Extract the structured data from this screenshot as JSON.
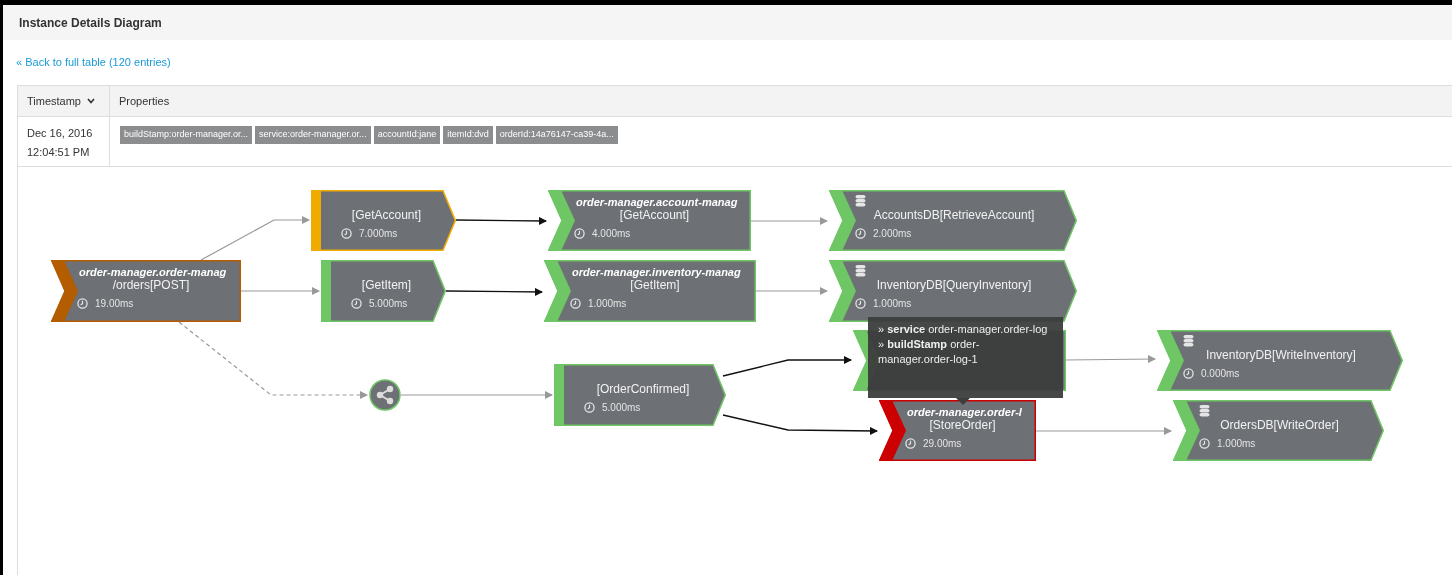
{
  "panel": {
    "title": "Instance Details Diagram"
  },
  "back_link": "« Back to full table (120 entries)",
  "table": {
    "columns": [
      {
        "label": "Timestamp",
        "sorted": true
      },
      {
        "label": "Properties",
        "sorted": false
      }
    ],
    "row": {
      "timestamp": [
        "Dec 16, 2016",
        "12:04:51 PM"
      ],
      "tags": [
        "buildStamp:order-manager.or...",
        "service:order-manager.or...",
        "accountId:jane",
        "itemId:dvd",
        "orderId:14a76147-ca39-4a..."
      ]
    }
  },
  "diagram": {
    "nodes": [
      {
        "kind": "service",
        "color": "#b35c00",
        "title": "order-manager.order-manag",
        "label": "/orders[POST]",
        "time": "19.00ms"
      },
      {
        "kind": "call",
        "color": "#f0ab00",
        "label": "[GetAccount]",
        "time": "7.000ms"
      },
      {
        "kind": "call",
        "color": "#6ec664",
        "label": "[GetItem]",
        "time": "5.000ms"
      },
      {
        "kind": "service",
        "color": "#6ec664",
        "title": "order-manager.account-manag",
        "label": "[GetAccount]",
        "time": "4.000ms"
      },
      {
        "kind": "service",
        "color": "#6ec664",
        "title": "order-manager.inventory-manag",
        "label": "[GetItem]",
        "time": "1.000ms"
      },
      {
        "kind": "database",
        "color": "#6ec664",
        "label": "AccountsDB[RetrieveAccount]",
        "time": "2.000ms"
      },
      {
        "kind": "database",
        "color": "#6ec664",
        "label": "InventoryDB[QueryInventory]",
        "time": "1.000ms"
      },
      {
        "kind": "service",
        "color": "#6ec664"
      },
      {
        "kind": "database",
        "color": "#6ec664",
        "label": "InventoryDB[WriteInventory]",
        "time": "0.000ms"
      },
      {
        "kind": "call",
        "color": "#6ec664",
        "label": "[OrderConfirmed]",
        "time": "5.000ms"
      },
      {
        "kind": "service",
        "color": "#cc0000",
        "title": "order-manager.order-l",
        "label": "[StoreOrder]",
        "time": "29.00ms"
      },
      {
        "kind": "database",
        "color": "#6ec664",
        "label": "OrdersDB[WriteOrder]",
        "time": "1.000ms"
      }
    ],
    "tooltip": [
      "» **service** order-manager.order-log",
      "» **buildStamp** order-manager.order-log-1"
    ]
  }
}
